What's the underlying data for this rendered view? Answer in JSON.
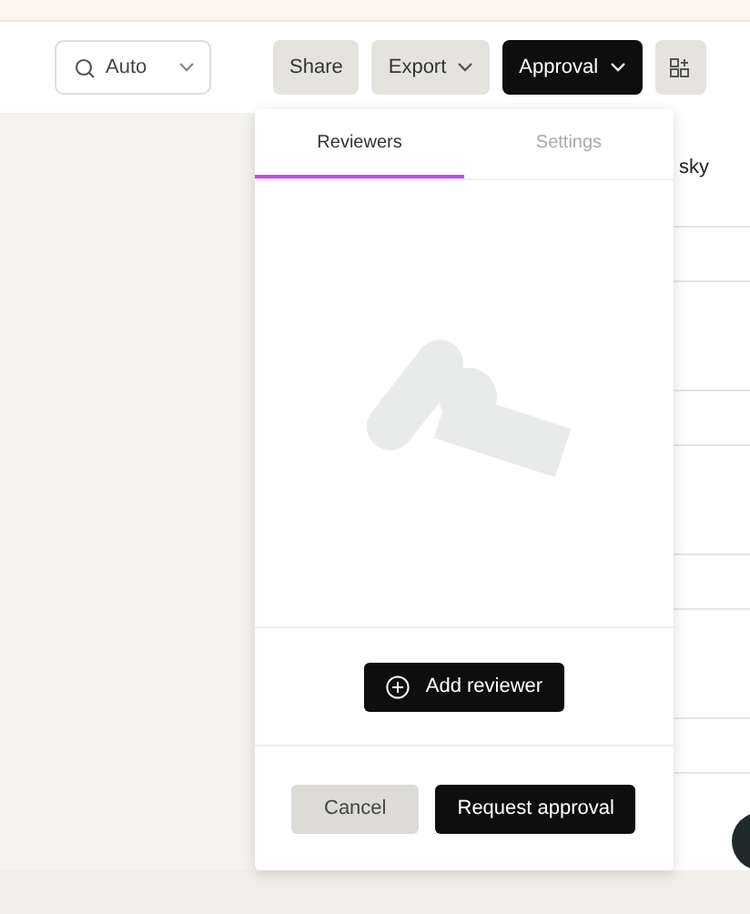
{
  "toolbar": {
    "zoom": {
      "value": "Auto"
    },
    "buttons": [
      {
        "label": "Share",
        "kind": "light",
        "dropdown": false
      },
      {
        "label": "Export",
        "kind": "light",
        "dropdown": true
      },
      {
        "label": "Approval",
        "kind": "dark",
        "dropdown": true
      }
    ]
  },
  "table": {
    "cell_text": "sky"
  },
  "approval_popover": {
    "tabs": [
      {
        "label": "Reviewers",
        "selected": true
      },
      {
        "label": "Settings",
        "selected": false
      }
    ],
    "add_button": {
      "label": "Add reviewer"
    },
    "footer_buttons": [
      {
        "label": "Cancel",
        "kind": "light"
      },
      {
        "label": "Request approval",
        "kind": "dark"
      }
    ]
  }
}
